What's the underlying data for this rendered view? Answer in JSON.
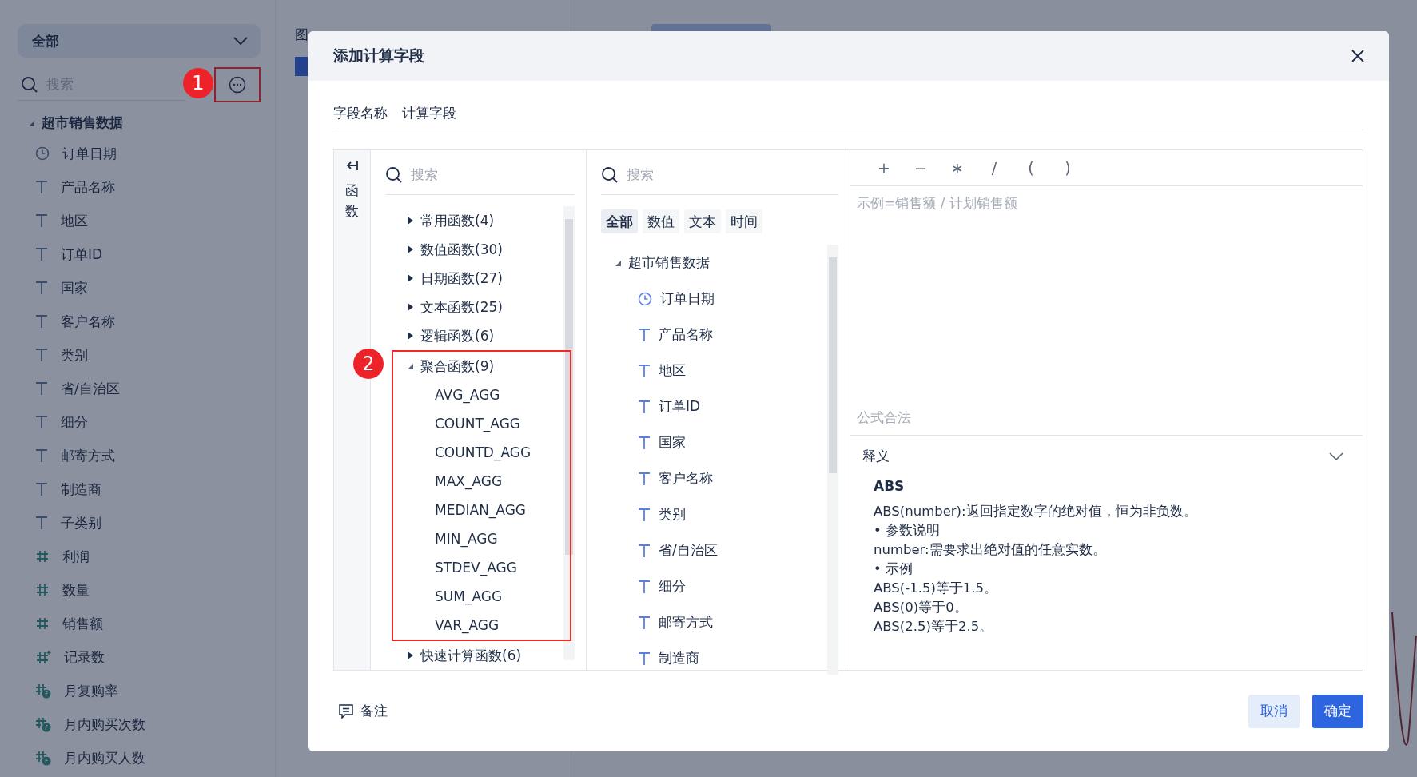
{
  "sidebar": {
    "scope_dropdown": {
      "value": "全部"
    },
    "search": {
      "placeholder": "搜索"
    },
    "more_button": {
      "marker": "1"
    },
    "tree": {
      "label": "超市销售数据",
      "expanded": true,
      "children": [
        {
          "label": "订单日期",
          "kind": "date"
        },
        {
          "label": "产品名称",
          "kind": "text"
        },
        {
          "label": "地区",
          "kind": "text"
        },
        {
          "label": "订单ID",
          "kind": "text"
        },
        {
          "label": "国家",
          "kind": "text"
        },
        {
          "label": "客户名称",
          "kind": "text"
        },
        {
          "label": "类别",
          "kind": "text"
        },
        {
          "label": "省/自治区",
          "kind": "text"
        },
        {
          "label": "细分",
          "kind": "text"
        },
        {
          "label": "邮寄方式",
          "kind": "text"
        },
        {
          "label": "制造商",
          "kind": "text"
        },
        {
          "label": "子类别",
          "kind": "text"
        },
        {
          "label": "利润",
          "kind": "number"
        },
        {
          "label": "数量",
          "kind": "number"
        },
        {
          "label": "销售额",
          "kind": "number"
        },
        {
          "label": "记录数",
          "kind": "count"
        },
        {
          "label": "月复购率",
          "kind": "calc"
        },
        {
          "label": "月内购买次数",
          "kind": "calc"
        },
        {
          "label": "月内购买人数",
          "kind": "calc"
        }
      ]
    }
  },
  "background_panel": {
    "title": "图"
  },
  "dialog": {
    "title": "添加计算字段",
    "field_name": {
      "label": "字段名称",
      "value": "计算字段"
    },
    "function_rail": {
      "label": "函数"
    },
    "functions": {
      "search": {
        "placeholder": "搜索"
      },
      "categories": [
        {
          "label": "常用函数(4)",
          "expanded": false
        },
        {
          "label": "数值函数(30)",
          "expanded": false
        },
        {
          "label": "日期函数(27)",
          "expanded": false
        },
        {
          "label": "文本函数(25)",
          "expanded": false
        },
        {
          "label": "逻辑函数(6)",
          "expanded": false
        },
        {
          "label": "聚合函数(9)",
          "expanded": true,
          "marker": "2",
          "children": [
            "AVG_AGG",
            "COUNT_AGG",
            "COUNTD_AGG",
            "MAX_AGG",
            "MEDIAN_AGG",
            "MIN_AGG",
            "STDEV_AGG",
            "SUM_AGG",
            "VAR_AGG"
          ]
        },
        {
          "label": "快速计算函数(6)",
          "expanded": false
        }
      ]
    },
    "fields": {
      "search": {
        "placeholder": "搜索"
      },
      "filters": [
        {
          "label": "全部",
          "selected": true
        },
        {
          "label": "数值",
          "selected": false
        },
        {
          "label": "文本",
          "selected": false
        },
        {
          "label": "时间",
          "selected": false
        }
      ],
      "tree": {
        "label": "超市销售数据",
        "expanded": true,
        "children": [
          {
            "label": "订单日期",
            "kind": "date"
          },
          {
            "label": "产品名称",
            "kind": "text"
          },
          {
            "label": "地区",
            "kind": "text"
          },
          {
            "label": "订单ID",
            "kind": "text"
          },
          {
            "label": "国家",
            "kind": "text"
          },
          {
            "label": "客户名称",
            "kind": "text"
          },
          {
            "label": "类别",
            "kind": "text"
          },
          {
            "label": "省/自治区",
            "kind": "text"
          },
          {
            "label": "细分",
            "kind": "text"
          },
          {
            "label": "邮寄方式",
            "kind": "text"
          },
          {
            "label": "制造商",
            "kind": "text"
          }
        ]
      }
    },
    "operators": [
      "+",
      "−",
      "∗",
      "/",
      "(",
      ")"
    ],
    "formula": {
      "placeholder": "示例=销售额 / 计划销售额"
    },
    "status": "公式合法",
    "definition": {
      "title": "释义",
      "expanded": true,
      "function_name": "ABS",
      "lines": [
        "ABS(number):返回指定数字的绝对值，恒为非负数。",
        "• 参数说明",
        "number:需要求出绝对值的任意实数。",
        "• 示例",
        "ABS(-1.5)等于1.5。",
        "ABS(0)等于0。",
        "ABS(2.5)等于2.5。"
      ]
    },
    "note_button": "备注",
    "buttons": [
      {
        "label": "取消",
        "kind": "secondary"
      },
      {
        "label": "确定",
        "kind": "primary"
      }
    ]
  }
}
